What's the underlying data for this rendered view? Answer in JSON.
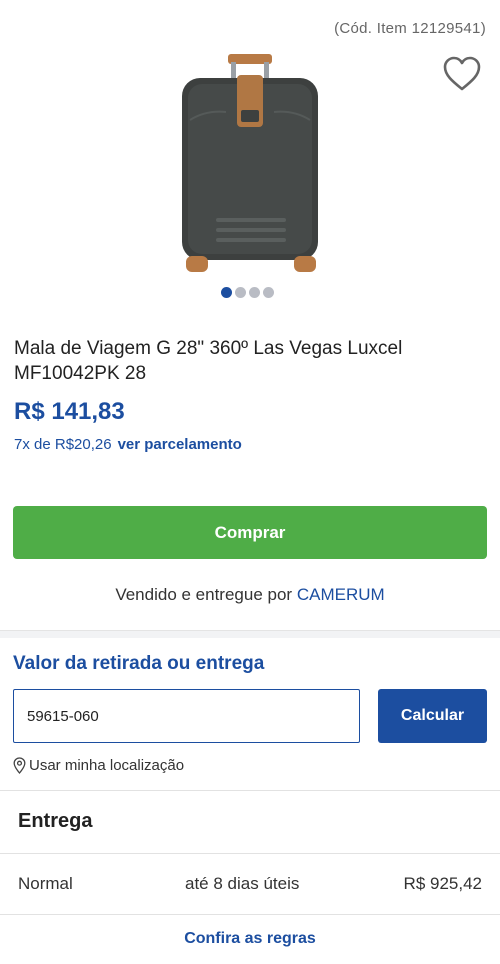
{
  "product": {
    "item_code": "(Cód. Item 12129541)",
    "image_icon": "suitcase-image",
    "title": "Mala de Viagem G 28\" 360º Las Vegas Luxcel MF10042PK 28",
    "price": "R$ 141,83",
    "installments_text": "7x de R$20,26",
    "installments_link": "ver parcelamento",
    "gallery": {
      "total": 4,
      "active": 1
    }
  },
  "actions": {
    "buy_label": "Comprar",
    "favorite_icon": "heart-icon"
  },
  "seller": {
    "prefix": "Vendido e entregue por",
    "name": "CAMERUM"
  },
  "shipping": {
    "title": "Valor da retirada ou entrega",
    "cep_value": "59615-060",
    "calculate_label": "Calcular",
    "location_icon": "map-pin-icon",
    "location_label": "Usar minha localização",
    "delivery_title": "Entrega",
    "options": [
      {
        "type": "Normal",
        "time": "até 8 dias úteis",
        "price": "R$ 925,42"
      }
    ],
    "rules_link": "Confira as regras"
  },
  "colors": {
    "brand_blue": "#1c4ea0",
    "buy_green": "#4fad47"
  }
}
